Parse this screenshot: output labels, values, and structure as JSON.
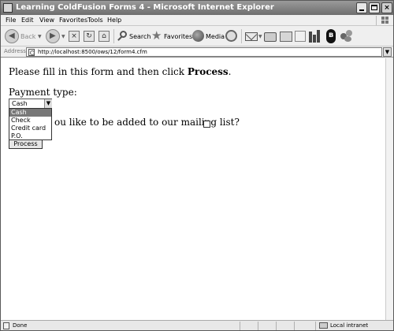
{
  "window": {
    "title": "Learning ColdFusion Forms 4 - Microsoft Internet Explorer",
    "minimize_glyph": "_",
    "close_glyph": "×"
  },
  "menu": [
    "File",
    "Edit",
    "View",
    "Favorites",
    "Tools",
    "Help"
  ],
  "toolbar": {
    "back_label": "Back",
    "back_arrow": "◀",
    "forward_arrow": "▶",
    "dropdown_glyph": "▼",
    "stop_glyph": "×",
    "refresh_glyph": "↻",
    "home_glyph": "⌂",
    "search_label": "Search",
    "favorites_label": "Favorites",
    "media_label": "Media",
    "bluetooth_glyph": "ʙ"
  },
  "address": {
    "label": "Address",
    "url": "http://localhost:8500/ows/12/form4.cfm",
    "dropdown_glyph": "▼"
  },
  "form": {
    "intro_prefix": "Please fill in this form and then click ",
    "intro_bold": "Process",
    "intro_suffix": ".",
    "payment_label": "Payment type:",
    "payment_selected": "Cash",
    "select_arrow": "▼",
    "payment_options": [
      "Cash",
      "Check",
      "Credit card",
      "P.O."
    ],
    "mailing_label": "ou like to be added to our mailing list?",
    "mailing_checked": false,
    "process_label": "Process"
  },
  "status": {
    "text": "Done",
    "zone": "Local intranet"
  },
  "colors": {
    "selected_option_bg": "#777777",
    "titlebar": "#7a7a7a"
  },
  "icons": [
    "app-icon",
    "back-arrow-icon",
    "forward-arrow-icon",
    "stop-icon",
    "refresh-icon",
    "home-icon",
    "search-icon",
    "favorites-star-icon",
    "media-icon",
    "history-icon",
    "mail-icon",
    "print-icon",
    "edit-icon",
    "discuss-icon",
    "research-icon",
    "bluetooth-icon",
    "messenger-icon",
    "page-icon",
    "windows-logo-icon",
    "intranet-zone-icon"
  ]
}
